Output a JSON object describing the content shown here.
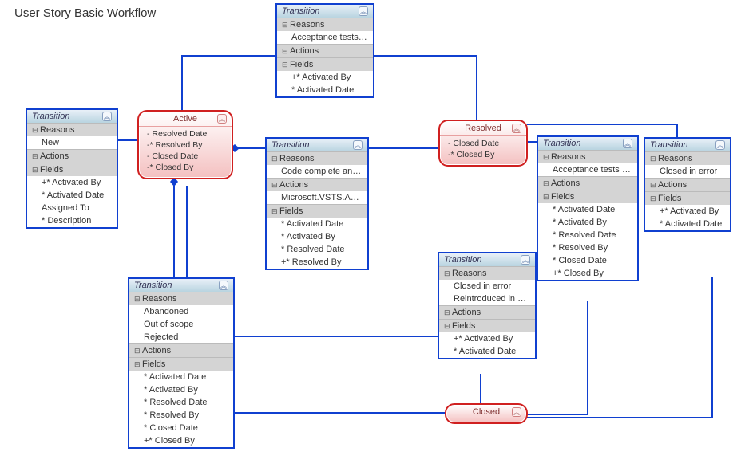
{
  "title": "User Story Basic Workflow",
  "labels": {
    "transition": "Transition",
    "reasons": "Reasons",
    "actions": "Actions",
    "fields": "Fields"
  },
  "states": {
    "active": {
      "title": "Active",
      "body": [
        "- Resolved Date",
        "-* Resolved By",
        "- Closed Date",
        "-* Closed By"
      ]
    },
    "resolved": {
      "title": "Resolved",
      "body": [
        "- Closed Date",
        "-* Closed By"
      ]
    },
    "closed": {
      "title": "Closed",
      "body": []
    }
  },
  "transitions": {
    "t_new": {
      "reasons": [
        "New"
      ],
      "actions": [],
      "fields": [
        "+* Activated By",
        "* Activated Date",
        "Assigned To",
        "* Description"
      ]
    },
    "t_accfail": {
      "reasons": [
        "Acceptance tests fail"
      ],
      "actions": [],
      "fields": [
        "+* Activated By",
        "* Activated Date"
      ]
    },
    "t_codecomplete": {
      "reasons": [
        "Code complete and..."
      ],
      "actions": [
        "Microsoft.VSTS.Acti..."
      ],
      "fields": [
        "* Activated Date",
        "* Activated By",
        "* Resolved Date",
        "+* Resolved By"
      ]
    },
    "t_accpass": {
      "reasons": [
        "Acceptance tests p..."
      ],
      "actions": [],
      "fields": [
        "* Activated Date",
        "* Activated By",
        "* Resolved Date",
        "* Resolved By",
        "* Closed Date",
        "+* Closed By"
      ]
    },
    "t_closederr_resolved": {
      "reasons": [
        "Closed in error"
      ],
      "actions": [],
      "fields": [
        "+* Activated By",
        "* Activated Date"
      ]
    },
    "t_closederr_reintro": {
      "reasons": [
        "Closed in error",
        "Reintroduced in Scope"
      ],
      "actions": [],
      "fields": [
        "+* Activated By",
        "* Activated Date"
      ]
    },
    "t_abandon": {
      "reasons": [
        "Abandoned",
        "Out of scope",
        "Rejected"
      ],
      "actions": [],
      "fields": [
        "* Activated Date",
        "* Activated By",
        "* Resolved Date",
        "* Resolved By",
        "* Closed Date",
        "+* Closed By"
      ]
    }
  }
}
